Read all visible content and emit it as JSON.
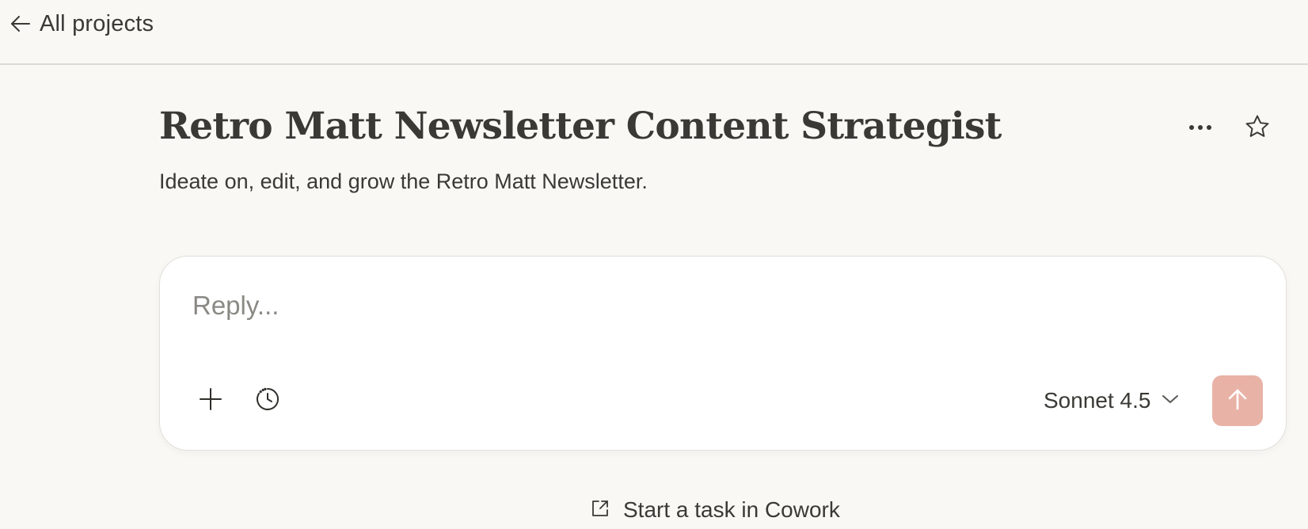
{
  "nav": {
    "back_label": "All projects",
    "back_icon": "arrow-left-icon"
  },
  "project": {
    "title": "Retro Matt Newsletter Content Strategist",
    "description": "Ideate on, edit, and grow the Retro Matt Newsletter.",
    "actions": {
      "more_icon": "more-horizontal-icon",
      "star_icon": "star-icon"
    }
  },
  "composer": {
    "placeholder": "Reply...",
    "value": "",
    "add_icon": "plus-icon",
    "history_icon": "clock-history-icon",
    "model": "Sonnet 4.5",
    "model_icon": "chevron-down-icon",
    "send_icon": "arrow-up-icon"
  },
  "footer": {
    "cowork_label": "Start a task in Cowork",
    "cowork_icon": "external-link-icon"
  },
  "colors": {
    "background": "#f9f8f4",
    "text": "#3a3935",
    "send_button": "#e8b3a6",
    "divider": "#dcdad4"
  }
}
